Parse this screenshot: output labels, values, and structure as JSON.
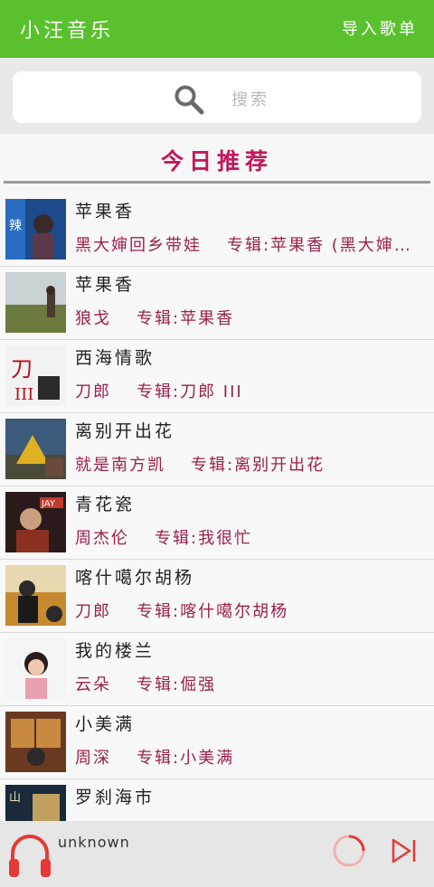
{
  "app": {
    "title": "小汪音乐",
    "import_label": "导入歌单"
  },
  "search": {
    "placeholder": "搜索"
  },
  "section": {
    "title": "今日推荐"
  },
  "songs": [
    {
      "title": "苹果香",
      "artist": "黑大婶回乡带娃",
      "album": "专辑:苹果香 (黑大婶回乡带娃版)"
    },
    {
      "title": "苹果香",
      "artist": "狼戈",
      "album": "专辑:苹果香"
    },
    {
      "title": "西海情歌",
      "artist": "刀郎",
      "album": "专辑:刀郎 III"
    },
    {
      "title": "离别开出花",
      "artist": "就是南方凯",
      "album": "专辑:离别开出花"
    },
    {
      "title": "青花瓷",
      "artist": "周杰伦",
      "album": "专辑:我很忙"
    },
    {
      "title": "喀什噶尔胡杨",
      "artist": "刀郎",
      "album": "专辑:喀什噶尔胡杨"
    },
    {
      "title": "我的楼兰",
      "artist": "云朵",
      "album": "专辑:倔强"
    },
    {
      "title": "小美满",
      "artist": "周深",
      "album": "专辑:小美满"
    },
    {
      "title": "罗刹海市",
      "artist": "",
      "album": ""
    }
  ],
  "player": {
    "now_playing": "unknown"
  },
  "colors": {
    "topbar": "#5ac02e",
    "accent": "#c2185b",
    "meta": "#9c1f4c",
    "player_icon": "#e53935"
  }
}
